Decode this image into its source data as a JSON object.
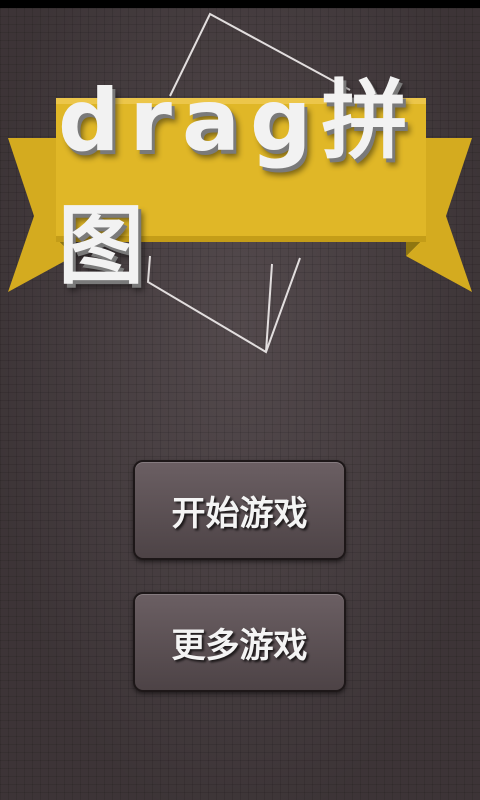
{
  "app": {
    "title": "drag拼图"
  },
  "menu": {
    "start_label": "开始游戏",
    "more_label": "更多游戏"
  },
  "colors": {
    "background": "#4a4043",
    "banner_yellow": "#dfb626",
    "banner_fold": "#8f7610",
    "button_face": "#5c5155",
    "text": "#f4f4f4"
  }
}
